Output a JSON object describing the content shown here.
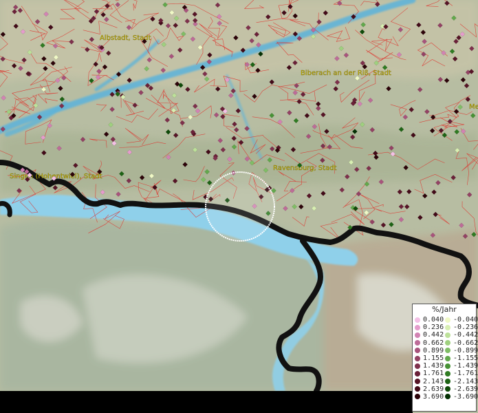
{
  "map": {
    "cities": [
      {
        "name": "Albstadt, Stadt"
      },
      {
        "name": "Biberach an der Riß, Stadt"
      },
      {
        "name": "Singen (Hohentwiel), Stadt"
      },
      {
        "name": "Ravensburg, Stadt"
      },
      {
        "name": "Me"
      }
    ],
    "colors": {
      "terrain": "#b9bfa4",
      "lake": "#8fd0ea",
      "river": "#5bb4d9",
      "boundary": "#e0302a",
      "border": "#111111",
      "selection_circle": "#ffffff"
    }
  },
  "legend": {
    "title": "%/Jahr",
    "positive": [
      {
        "label": "0.040",
        "color": "#f4c0e6"
      },
      {
        "label": "0.236",
        "color": "#e59ccc"
      },
      {
        "label": "0.442",
        "color": "#d283b3"
      },
      {
        "label": "0.662",
        "color": "#bd6c98"
      },
      {
        "label": "0.899",
        "color": "#a8537c"
      },
      {
        "label": "1.155",
        "color": "#934264"
      },
      {
        "label": "1.439",
        "color": "#7e304c"
      },
      {
        "label": "1.761",
        "color": "#6a2038"
      },
      {
        "label": "2.143",
        "color": "#561426"
      },
      {
        "label": "2.639",
        "color": "#420a18"
      },
      {
        "label": "3.690",
        "color": "#2c0309"
      }
    ],
    "negative": [
      {
        "label": "-0.040",
        "color": "#f0f9c6"
      },
      {
        "label": "-0.236",
        "color": "#d8efb2"
      },
      {
        "label": "-0.442",
        "color": "#bde19a"
      },
      {
        "label": "-0.662",
        "color": "#9fd07f"
      },
      {
        "label": "-0.899",
        "color": "#80bd66"
      },
      {
        "label": "-1.155",
        "color": "#62a84c"
      },
      {
        "label": "-1.439",
        "color": "#479235"
      },
      {
        "label": "-1.761",
        "color": "#2f7b22"
      },
      {
        "label": "-2.143",
        "color": "#1d6314"
      },
      {
        "label": "-2.639",
        "color": "#0e4a08"
      },
      {
        "label": "-3.690",
        "color": "#033003"
      }
    ]
  }
}
